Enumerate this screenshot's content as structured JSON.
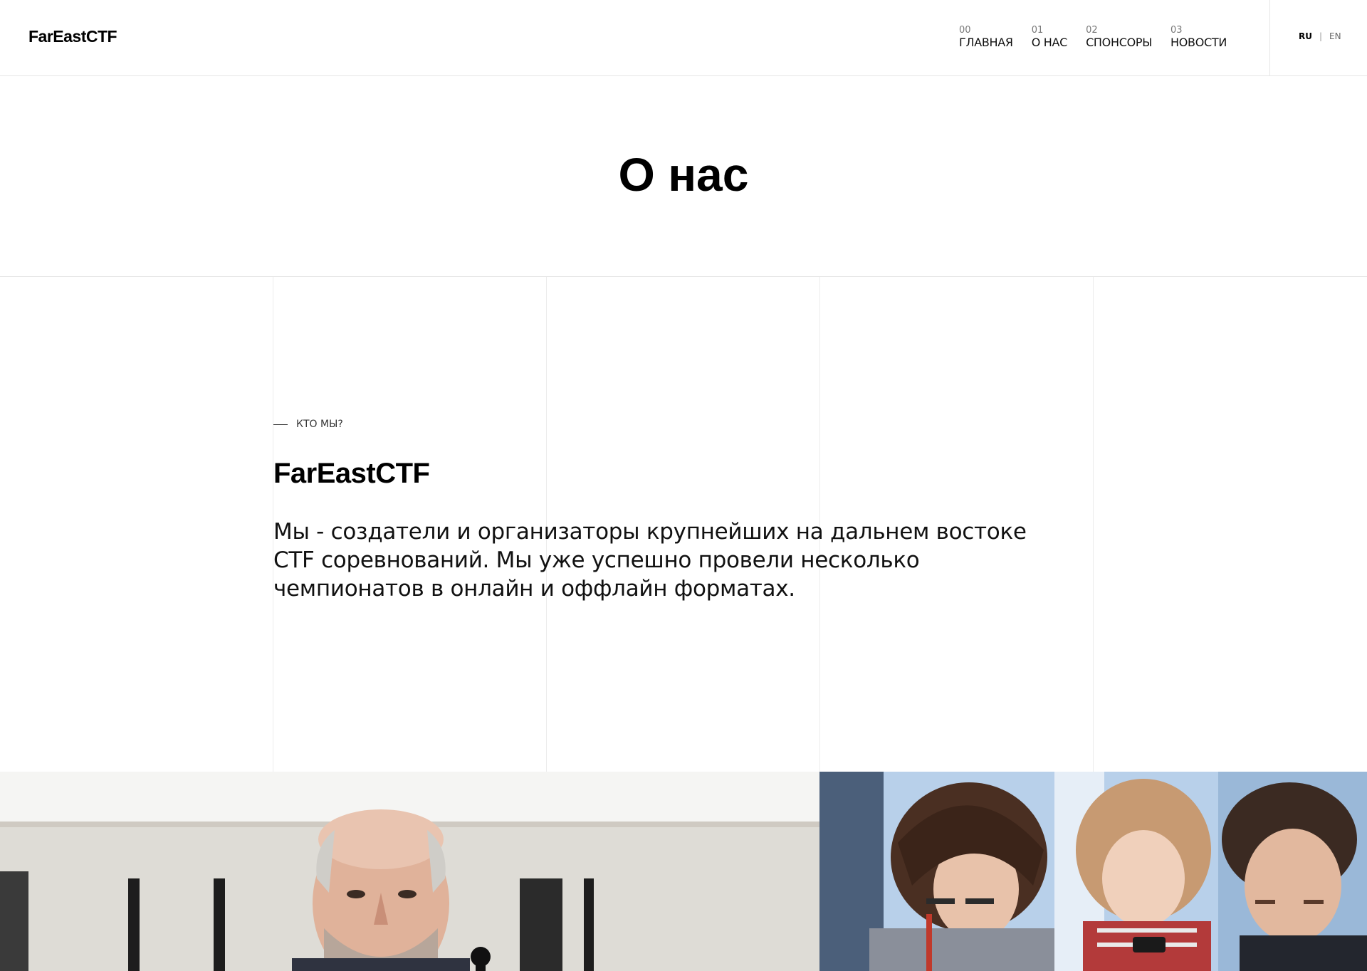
{
  "header": {
    "logo": "FarEastCTF",
    "nav": [
      {
        "num": "00",
        "label": "ГЛАВНАЯ"
      },
      {
        "num": "01",
        "label": "О НАС"
      },
      {
        "num": "02",
        "label": "СПОНСОРЫ"
      },
      {
        "num": "03",
        "label": "НОВОСТИ"
      }
    ],
    "lang": {
      "ru": "RU",
      "sep": "|",
      "en": "EN"
    }
  },
  "hero": {
    "title": "О нас"
  },
  "about": {
    "eyebrow": "КТО МЫ?",
    "title": "FarEastCTF",
    "text": "Мы - создатели и организаторы крупнейших на дальнем востоке CTF соревнований. Мы уже успешно провели несколько чемпионатов в онлайн и оффлайн форматах."
  },
  "photos": [
    {
      "name": "speaker-photo",
      "icon": "person-at-microphone"
    },
    {
      "name": "participants-photo",
      "icon": "students-with-phone"
    }
  ]
}
